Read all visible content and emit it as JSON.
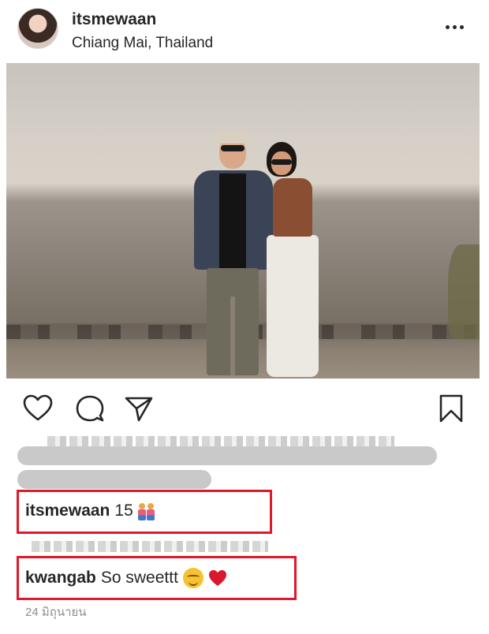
{
  "post": {
    "username": "itsmewaan",
    "location": "Chiang Mai, Thailand",
    "date": "24 มิถุนายน"
  },
  "icons": {
    "more": "more-options-icon",
    "like": "heart-outline-icon",
    "comment": "comment-icon",
    "share": "paper-plane-icon",
    "save": "bookmark-icon"
  },
  "comments": [
    {
      "user": "itsmewaan",
      "text": "15",
      "emoji": "couple-emoji"
    },
    {
      "user": "kwangab",
      "text": "So sweettt",
      "emoji": "smiling-face-and-red-heart-emoji"
    }
  ],
  "colors": {
    "highlight": "#e0182a",
    "text": "#262626",
    "muted": "#8e8e8e"
  }
}
